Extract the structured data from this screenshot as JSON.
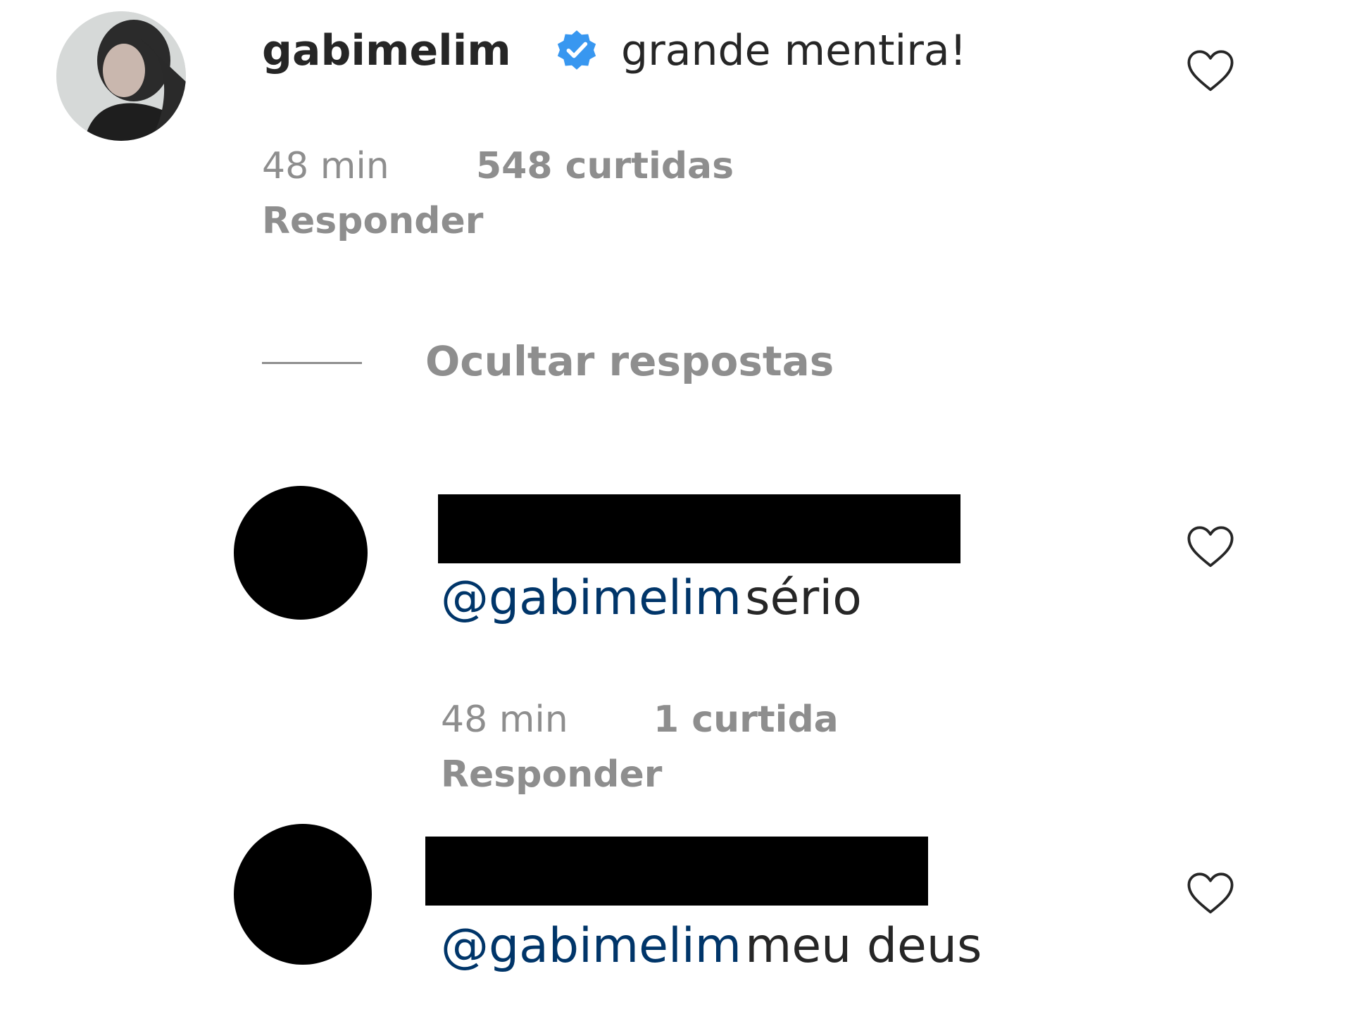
{
  "main_comment": {
    "username": "gabimelim",
    "verified": true,
    "text": "grande mentira!",
    "time": "48 min",
    "likes": "548 curtidas",
    "reply_label": "Responder"
  },
  "hide_replies_label": "Ocultar respostas",
  "replies": [
    {
      "mention": "@gabimelim",
      "text": "sério",
      "time": "48 min",
      "likes": "1 curtida",
      "reply_label": "Responder"
    },
    {
      "mention": "@gabimelim",
      "text": "meu deus"
    }
  ],
  "colors": {
    "verified_badge": "#3897f0",
    "mention": "#003569",
    "secondary_text": "#8e8e8e"
  }
}
